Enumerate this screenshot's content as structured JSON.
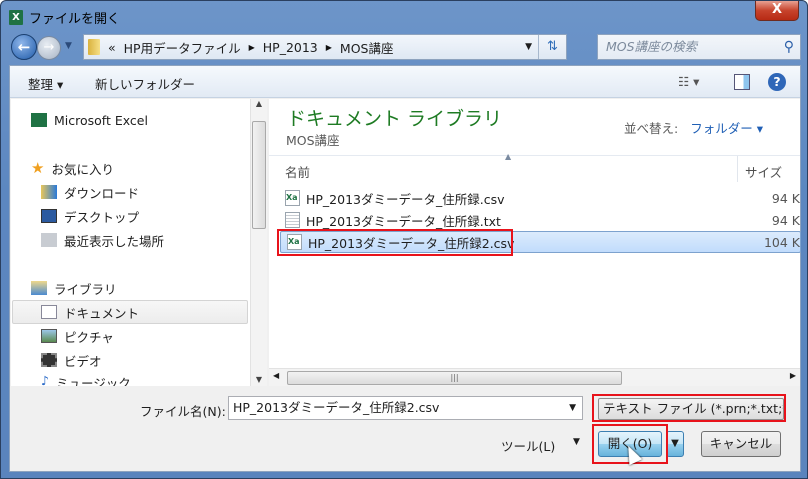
{
  "window": {
    "title": "ファイルを開く",
    "close_label": "X"
  },
  "nav": {
    "breadcrumb": [
      "«",
      "HP用データファイル",
      "HP_2013",
      "MOS講座"
    ],
    "search_placeholder": "MOS講座の検索"
  },
  "toolbar": {
    "organize": "整理 ▾",
    "new_folder": "新しいフォルダー"
  },
  "sidebar": {
    "items": [
      {
        "label": "Microsoft Excel",
        "icon": "excel-icon"
      },
      {
        "label": "お気に入り",
        "icon": "star-icon"
      },
      {
        "label": "ダウンロード",
        "icon": "download-folder-icon"
      },
      {
        "label": "デスクトップ",
        "icon": "desktop-icon"
      },
      {
        "label": "最近表示した場所",
        "icon": "recent-places-icon"
      },
      {
        "label": "ライブラリ",
        "icon": "library-icon"
      },
      {
        "label": "ドキュメント",
        "icon": "document-icon",
        "selected": true
      },
      {
        "label": "ピクチャ",
        "icon": "picture-icon"
      },
      {
        "label": "ビデオ",
        "icon": "video-icon"
      },
      {
        "label": "ミュージック",
        "icon": "music-icon"
      }
    ]
  },
  "main": {
    "library_title": "ドキュメント ライブラリ",
    "library_subtitle": "MOS講座",
    "sort_label": "並べ替え:",
    "sort_value": "フォルダー ▾",
    "columns": {
      "name": "名前",
      "size": "サイズ"
    },
    "files": [
      {
        "name": "HP_2013ダミーデータ_住所録.csv",
        "size": "94 K",
        "type": "csv"
      },
      {
        "name": "HP_2013ダミーデータ_住所録.txt",
        "size": "94 K",
        "type": "txt"
      },
      {
        "name": "HP_2013ダミーデータ_住所録2.csv",
        "size": "104 K",
        "type": "csv",
        "selected": true
      }
    ]
  },
  "footer": {
    "filename_label": "ファイル名(N):",
    "filename_value": "HP_2013ダミーデータ_住所録2.csv",
    "filetype_value": "テキスト ファイル (*.prn;*.txt;*.csv)",
    "tools_label": "ツール(L)",
    "open_label": "開く(O)",
    "cancel_label": "キャンセル"
  },
  "colors": {
    "accent": "#1e7b23",
    "highlight": "#e8131b",
    "selection": "#c1dcfc"
  }
}
